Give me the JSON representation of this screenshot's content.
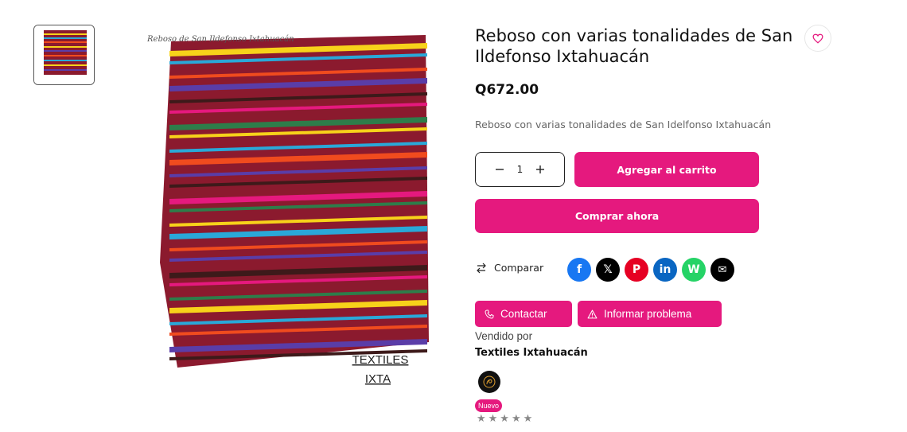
{
  "product": {
    "title": "Reboso con varias tonalidades de San Ildefonso Ixtahuacán",
    "price": "Q672.00",
    "description": "Reboso con varias tonalidades de San Idelfonso Ixtahuacán",
    "image_caption": "Reboso de San Ildefonso Ixtahuacán",
    "watermark": [
      "TEXTILES",
      "IXTA"
    ]
  },
  "quantity": {
    "value": "1",
    "minus_icon": "minus-icon",
    "plus_icon": "plus-icon"
  },
  "actions": {
    "add_to_cart": "Agregar al carrito",
    "buy_now": "Comprar ahora",
    "compare": "Comparar",
    "contact": "Contactar",
    "report": "Informar problema"
  },
  "share": [
    {
      "name": "facebook",
      "glyph": "f",
      "color": "#1877f2"
    },
    {
      "name": "x",
      "glyph": "𝕏",
      "color": "#000000"
    },
    {
      "name": "pinterest",
      "glyph": "P",
      "color": "#e60023"
    },
    {
      "name": "linkedin",
      "glyph": "in",
      "color": "#0a66c2"
    },
    {
      "name": "whatsapp",
      "glyph": "W",
      "color": "#25d366"
    },
    {
      "name": "email",
      "glyph": "✉",
      "color": "#000000"
    }
  ],
  "seller": {
    "label": "Vendido por",
    "name": "Textiles Ixtahuacán",
    "badge": "Nuevo",
    "rating_stars": "★★★★★"
  },
  "colors": {
    "accent": "#e5197e"
  }
}
